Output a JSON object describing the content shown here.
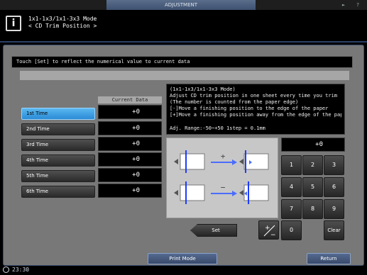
{
  "top": {
    "tab_label": "ADJUSTMENT",
    "icons": [
      "speaker-icon",
      "help-icon"
    ]
  },
  "header": {
    "mode_line1": "1x1-1x3/1x1-3x3 Mode",
    "mode_line2": "< CD Trim Position >"
  },
  "info_message": "Touch [Set] to reflect the numerical value to current data",
  "current_data_header": "Current Data",
  "times": [
    {
      "label": "1st Time",
      "value": "+0",
      "selected": true
    },
    {
      "label": "2nd Time",
      "value": "+0",
      "selected": false
    },
    {
      "label": "3rd Time",
      "value": "+0",
      "selected": false
    },
    {
      "label": "4th Time",
      "value": "+0",
      "selected": false
    },
    {
      "label": "5th Time",
      "value": "+0",
      "selected": false
    },
    {
      "label": "6th Time",
      "value": "+0",
      "selected": false
    }
  ],
  "description": {
    "lines": [
      "(1x1-1x3/1x1-3x3 Mode)",
      "Adjust CD trim position in one sheet every time you trim",
      "(The number is counted from the paper edge)",
      "[-]Move a finishing position to the edge of the paper",
      "[+]Move a finishing position away from the edge of the paper"
    ],
    "range": "Adj. Range:-50~+50 1step = 0.1mm"
  },
  "diagram": {
    "plus_sign": "+",
    "minus_sign": "−"
  },
  "keypad": {
    "display": "+0",
    "keys": [
      "1",
      "2",
      "3",
      "4",
      "5",
      "6",
      "7",
      "8",
      "9",
      "0",
      "Clear"
    ],
    "plus_minus": "+/−"
  },
  "set_label": "Set",
  "print_mode_label": "Print Mode",
  "return_label": "Return",
  "clock": "23:30",
  "colors": {
    "selected": "#3aa0e8",
    "arrow": "#4a6cff",
    "accent_line": "#1e3cff"
  }
}
